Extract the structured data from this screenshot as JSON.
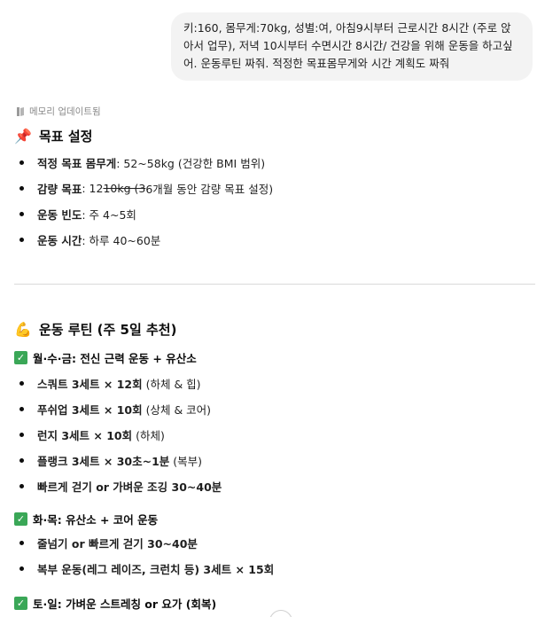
{
  "user_message": "키:160, 몸무게:70kg, 성별:여, 아침9시부터 근로시간 8시간 (주로 앉아서 업무), 저녁 10시부터 수면시간 8시간/ 건강을 위해 운동을 하고싶어. 운동루틴 짜줘. 적정한 목표몸무게와 시간 계획도 짜줘",
  "memory_note": "메모리 업데이트됨",
  "goal_section": {
    "emoji": "📌",
    "title": "목표 설정",
    "items": [
      {
        "label": "적정 목표 몸무게",
        "value": ": 52~58kg (건강한 BMI 범위)"
      },
      {
        "label": "감량 목표",
        "value_prefix": ": 12",
        "value_strike": "10kg (3",
        "value_suffix": "6개월 동안 감량 목표 설정)"
      },
      {
        "label": "운동 빈도",
        "value": ": 주 4~5회"
      },
      {
        "label": "운동 시간",
        "value": ": 하루 40~60분"
      }
    ]
  },
  "routine_section": {
    "emoji": "💪",
    "title": "운동 루틴 (주 5일 추천)",
    "days": [
      {
        "head": "월·수·금: 전신 근력 운동 + 유산소",
        "items": [
          {
            "bold": "스쿼트 3세트 × 12회",
            "rest": " (하체 & 힙)"
          },
          {
            "bold": "푸쉬업 3세트 × 10회",
            "rest": " (상체 & 코어)"
          },
          {
            "bold": "런지 3세트 × 10회",
            "rest": " (하체)"
          },
          {
            "bold": "플랭크 3세트 × 30초~1분",
            "rest": " (복부)"
          },
          {
            "bold": "빠르게 걷기 or 가벼운 조깅 30~40분",
            "rest": ""
          }
        ]
      },
      {
        "head": "화·목: 유산소 + 코어 운동",
        "items": [
          {
            "bold": "줄넘기 or 빠르게 걷기 30~40분",
            "rest": ""
          },
          {
            "bold": "복부 운동(레그 레이즈, 크런치 등) 3세트 × 15회",
            "rest": ""
          }
        ]
      },
      {
        "head": "토·일: 가벼운 스트레칭 or 요가 (회복)",
        "items": []
      }
    ]
  },
  "check_icon": "✓",
  "colors": {
    "check_green": "#3aa757",
    "bubble_bg": "#f3f3f3",
    "divider": "#d9d9d9"
  }
}
